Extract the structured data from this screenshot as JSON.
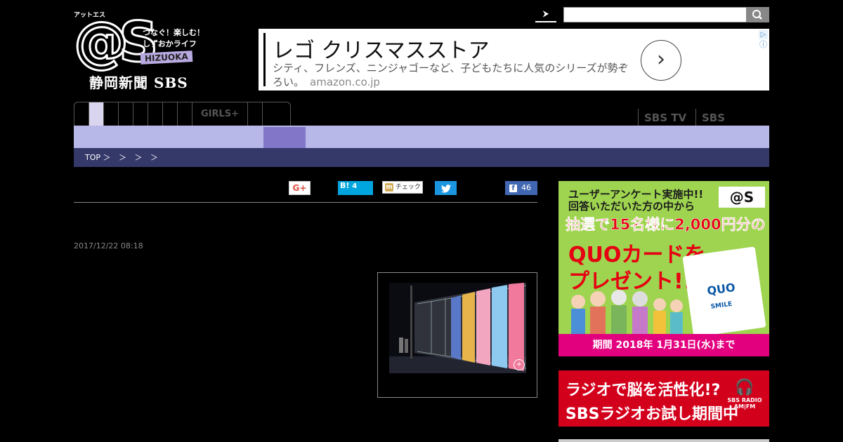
{
  "logo": {
    "vertical_text": "アットエス",
    "mark": "@S",
    "tagline_1": "つなぐ！楽しむ！",
    "tagline_2": "しずおかライフ",
    "region": "HIZUOKA",
    "publisher": "静岡新聞 SBS"
  },
  "search": {
    "arrow_label": "⮞",
    "placeholder": "",
    "submit_icon": "search-icon"
  },
  "ad": {
    "headline": "レゴ クリスマスストア",
    "description": "シティ、フレンズ、ニンジャゴーなど、子どもたちに人気のシリーズが勢ぞろい。",
    "domain": "amazon.co.jp",
    "arrow": "›",
    "info_icon": "ⓘ"
  },
  "nav": {
    "girls_label": "GIRLS+",
    "sbs_tv": "SBS TV",
    "sbs_radio": "SBS RADIO"
  },
  "breadcrumb": {
    "items": [
      "TOP ＞",
      "＞",
      "＞",
      "＞"
    ]
  },
  "social": {
    "gplus": "G+",
    "hatena_label": "B!",
    "hatena_count": "4",
    "mixi_label": "チェック",
    "facebook_count": "46"
  },
  "article": {
    "date": "2017/12/22 08:18"
  },
  "banner1": {
    "line1": "ユーザーアンケート実施中!!",
    "line2": "回答いただいた方の中から",
    "line3": "抽選で15名様に2,000円分の",
    "line4": "QUOカードを",
    "line5": "プレゼント!!",
    "card_brand": "QUO",
    "card_sub": "SMILE",
    "logo": "@S",
    "footer": "期間 2018年 1月31日(水)まで"
  },
  "banner2": {
    "line1": "ラジオで脳を活性化!?",
    "line2": "SBSラジオお試し期間中",
    "radio_label": "SBS RADIO AM|FM"
  },
  "colors": {
    "subnav_bg": "#b8b8e8",
    "subnav_active": "#8276c8",
    "breadcrumb_bg": "#34396a",
    "active_tab": "#d9d5ef"
  }
}
